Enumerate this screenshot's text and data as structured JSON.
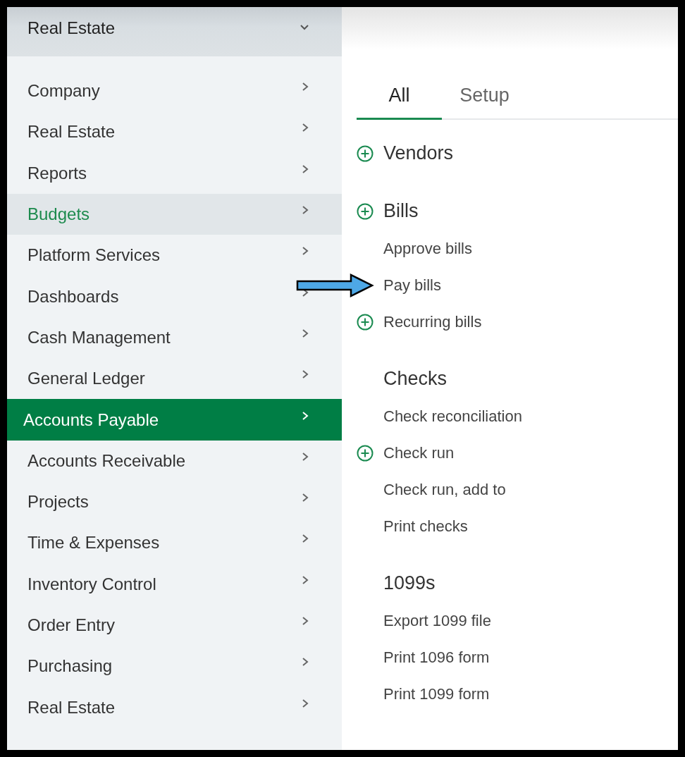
{
  "sidebar": {
    "header": {
      "label": "Real Estate"
    },
    "items": [
      {
        "label": "Company",
        "selected": false,
        "highlighted": false
      },
      {
        "label": "Real Estate",
        "selected": false,
        "highlighted": false
      },
      {
        "label": "Reports",
        "selected": false,
        "highlighted": false
      },
      {
        "label": "Budgets",
        "selected": false,
        "highlighted": true
      },
      {
        "label": "Platform Services",
        "selected": false,
        "highlighted": false
      },
      {
        "label": "Dashboards",
        "selected": false,
        "highlighted": false
      },
      {
        "label": "Cash Management",
        "selected": false,
        "highlighted": false
      },
      {
        "label": "General Ledger",
        "selected": false,
        "highlighted": false
      },
      {
        "label": "Accounts Payable",
        "selected": true,
        "highlighted": false
      },
      {
        "label": "Accounts Receivable",
        "selected": false,
        "highlighted": false
      },
      {
        "label": "Projects",
        "selected": false,
        "highlighted": false
      },
      {
        "label": "Time & Expenses",
        "selected": false,
        "highlighted": false
      },
      {
        "label": "Inventory Control",
        "selected": false,
        "highlighted": false
      },
      {
        "label": "Order Entry",
        "selected": false,
        "highlighted": false
      },
      {
        "label": "Purchasing",
        "selected": false,
        "highlighted": false
      },
      {
        "label": "Real Estate",
        "selected": false,
        "highlighted": false
      }
    ]
  },
  "tabs": [
    {
      "label": "All",
      "selected": true
    },
    {
      "label": "Setup",
      "selected": false
    }
  ],
  "sections": [
    {
      "title": "Vendors",
      "add": true
    },
    {
      "title": "Bills",
      "add": true,
      "items": [
        {
          "label": "Approve bills",
          "add": false,
          "pointed": false
        },
        {
          "label": "Pay bills",
          "add": false,
          "pointed": true
        },
        {
          "label": "Recurring bills",
          "add": true,
          "pointed": false
        }
      ]
    },
    {
      "title": "Checks",
      "add": false,
      "items": [
        {
          "label": "Check reconciliation",
          "add": false,
          "pointed": false
        },
        {
          "label": "Check run",
          "add": true,
          "pointed": false
        },
        {
          "label": "Check run, add to",
          "add": false,
          "pointed": false
        },
        {
          "label": "Print checks",
          "add": false,
          "pointed": false
        }
      ]
    },
    {
      "title": "1099s",
      "add": false,
      "items": [
        {
          "label": "Export 1099 file",
          "add": false,
          "pointed": false
        },
        {
          "label": "Print 1096 form",
          "add": false,
          "pointed": false
        },
        {
          "label": "Print 1099 form",
          "add": false,
          "pointed": false
        }
      ]
    }
  ]
}
